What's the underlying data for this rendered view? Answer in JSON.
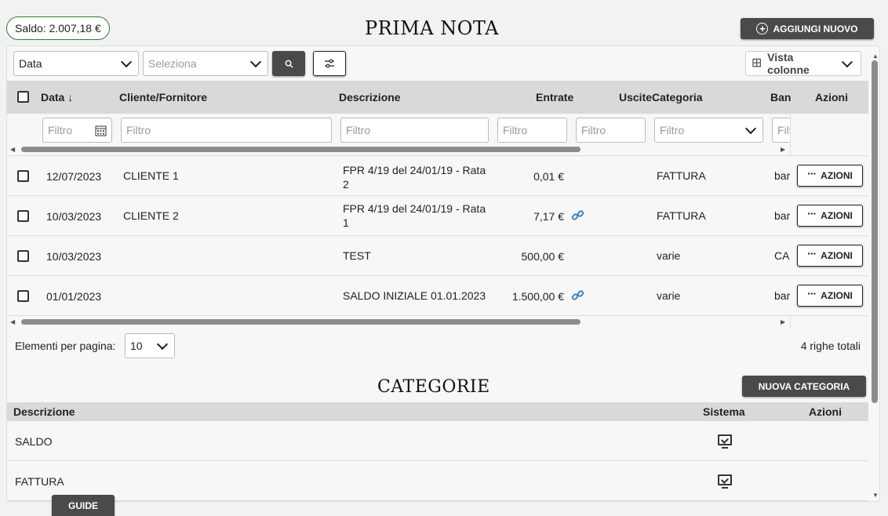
{
  "header": {
    "saldo": "Saldo: 2.007,18 €",
    "title": "PRIMA NOTA",
    "add_button": "AGGIUNGI NUOVO"
  },
  "toolbar": {
    "field_select": "Data",
    "value_select_placeholder": "Seleziona",
    "view_columns": "Vista colonne"
  },
  "table": {
    "columns": [
      "Data",
      "Cliente/Fornitore",
      "Descrizione",
      "Entrate",
      "Uscite",
      "Categoria",
      "Ban",
      "Azioni"
    ],
    "sort_indicator": "↓",
    "filter_placeholder": "Filtro",
    "rows": [
      {
        "data": "12/07/2023",
        "cliente": "CLIENTE 1",
        "descrizione": "FPR 4/19 del 24/01/19 - Rata 2",
        "entrate": "0,01 €",
        "link": false,
        "categoria": "FATTURA",
        "banca": "bar"
      },
      {
        "data": "10/03/2023",
        "cliente": "CLIENTE 2",
        "descrizione": "FPR 4/19 del 24/01/19 - Rata 1",
        "entrate": "7,17 €",
        "link": true,
        "categoria": "FATTURA",
        "banca": "bar"
      },
      {
        "data": "10/03/2023",
        "cliente": "",
        "descrizione": "TEST",
        "entrate": "500,00 €",
        "link": false,
        "categoria": "varie",
        "banca": "CA"
      },
      {
        "data": "01/01/2023",
        "cliente": "",
        "descrizione": "SALDO INIZIALE 01.01.2023",
        "entrate": "1.500,00 €",
        "link": true,
        "categoria": "varie",
        "banca": "bar"
      }
    ],
    "row_action": "AZIONI"
  },
  "pagination": {
    "label": "Elementi per pagina:",
    "page_size": "10",
    "total": "4 righe totali"
  },
  "categorie": {
    "title": "CATEGORIE",
    "new_button": "NUOVA CATEGORIA",
    "columns": [
      "Descrizione",
      "Sistema",
      "Azioni"
    ],
    "rows": [
      {
        "descrizione": "SALDO"
      },
      {
        "descrizione": "FATTURA"
      }
    ]
  },
  "footer": {
    "guide": "GUIDE"
  },
  "colors": {
    "dark_button": "#4a4a4a",
    "saldo_border": "#2e7d32",
    "link": "#3a86c8",
    "header_bg": "#d9d9d9"
  }
}
